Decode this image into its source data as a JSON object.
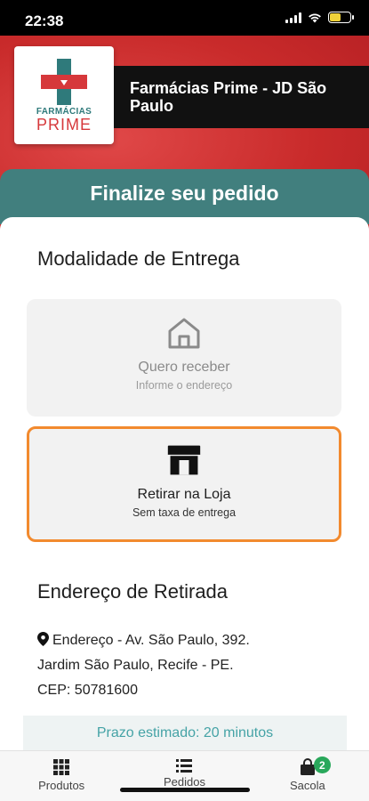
{
  "status_bar": {
    "time": "22:38"
  },
  "store": {
    "logo_top": "FARMÁCIAS",
    "logo_bottom": "PRIME",
    "name": "Farmácias Prime - JD São Paulo"
  },
  "page": {
    "title": "Finalize seu pedido"
  },
  "delivery": {
    "section_title": "Modalidade de Entrega",
    "options": [
      {
        "title": "Quero receber",
        "subtitle": "Informe o endereço",
        "icon": "home-icon",
        "selected": false
      },
      {
        "title": "Retirar na Loja",
        "subtitle": "Sem taxa de entrega",
        "icon": "store-icon",
        "selected": true
      }
    ]
  },
  "pickup": {
    "section_title": "Endereço de Retirada",
    "address": "Endereço - Av. São Paulo, 392. Jardim São Paulo, Recife - PE. CEP: 50781600",
    "eta": "Prazo estimado: 20 minutos"
  },
  "nav": {
    "items": [
      {
        "label": "Produtos",
        "icon": "grid-icon"
      },
      {
        "label": "Pedidos",
        "icon": "list-icon"
      },
      {
        "label": "Sacola",
        "icon": "bag-icon",
        "badge": "2"
      }
    ]
  },
  "colors": {
    "brand_red": "#c92b2b",
    "teal": "#417f7e",
    "selected_border": "#f28a2e",
    "badge_green": "#29a85b"
  }
}
